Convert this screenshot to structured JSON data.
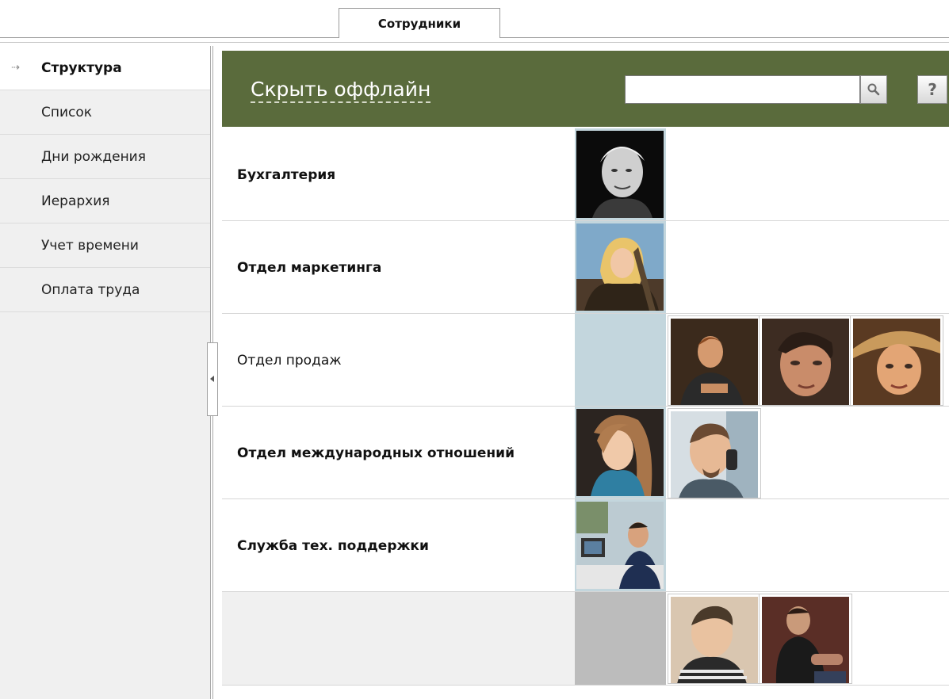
{
  "tabs": [
    {
      "label": "Сотрудники",
      "active": true
    }
  ],
  "sidebar": {
    "items": [
      {
        "label": "Структура",
        "active": true
      },
      {
        "label": "Список"
      },
      {
        "label": "Дни рождения"
      },
      {
        "label": "Иерархия"
      },
      {
        "label": "Учет времени"
      },
      {
        "label": "Оплата труда"
      }
    ]
  },
  "header": {
    "hide_offline_label": "Скрыть оффлайн",
    "search": {
      "value": "",
      "placeholder": ""
    },
    "search_icon": "magnifier-icon",
    "help_label": "?"
  },
  "departments": [
    {
      "name": "Бухгалтерия",
      "bold": true,
      "head_photo": "portrait-bw-man",
      "members": []
    },
    {
      "name": "Отдел маркетинга",
      "bold": true,
      "head_photo": "portrait-blonde-woman",
      "members": []
    },
    {
      "name": "Отдел продаж",
      "bold": false,
      "head_photo": null,
      "members": [
        "portrait-man-jacket",
        "portrait-man-closeup",
        "portrait-man-hat"
      ]
    },
    {
      "name": "Отдел международных отношений",
      "bold": true,
      "head_photo": "portrait-woman-scarf",
      "members": [
        "portrait-man-phone"
      ]
    },
    {
      "name": "Служба тех. поддержки",
      "bold": true,
      "head_photo": "portrait-man-desk",
      "members": []
    },
    {
      "name": "",
      "bold": false,
      "head_photo": null,
      "members": [
        "portrait-man-stripes",
        "portrait-man-black-shirt"
      ]
    }
  ],
  "colors": {
    "header_bg": "#5a6b3c",
    "lead_cell_empty": "#c3d6dd",
    "lead_cell_grey": "#bcbcbc",
    "unassigned_row_bg": "#f0f0f0"
  }
}
